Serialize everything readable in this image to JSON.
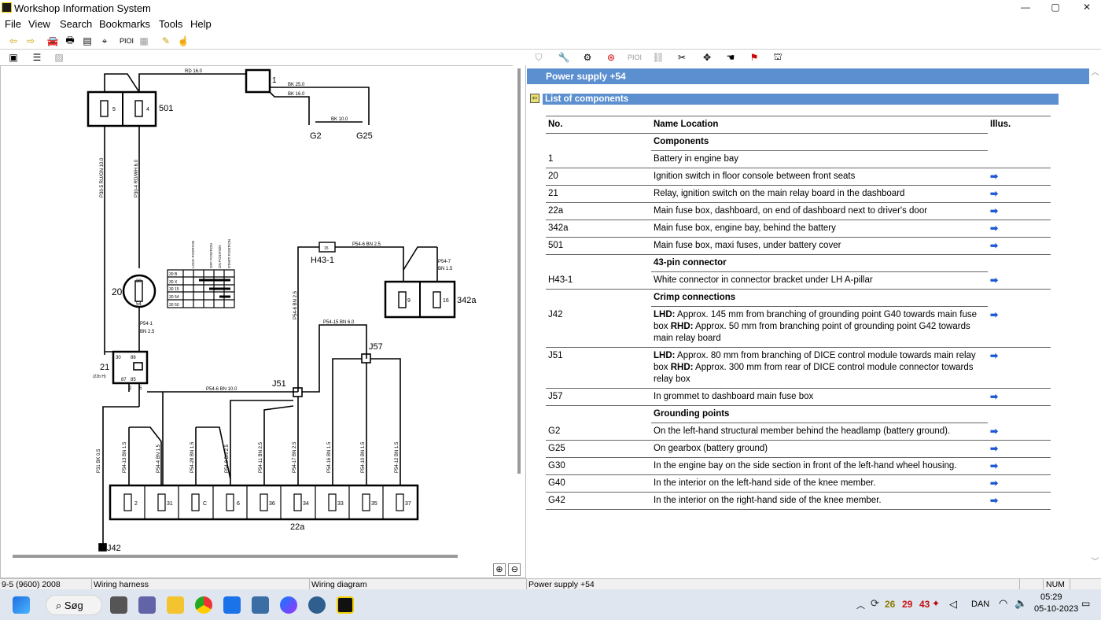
{
  "window": {
    "title": "Workshop Information System"
  },
  "menu": [
    "File",
    "View",
    "Search",
    "Bookmarks",
    "Tools",
    "Help"
  ],
  "right_panel": {
    "header": "Power supply +54",
    "list_title": "List of components",
    "columns": {
      "no": "No.",
      "name": "Name Location",
      "illus": "Illus."
    },
    "rows": [
      {
        "group": "Components"
      },
      {
        "no": "1",
        "name": "Battery in engine bay",
        "arrow": ""
      },
      {
        "no": "20",
        "name": "Ignition switch in floor console between front seats",
        "arrow": "➡"
      },
      {
        "no": "21",
        "name": "Relay, ignition switch on the main relay board in the dashboard",
        "arrow": "➡"
      },
      {
        "no": "22a",
        "name": "Main fuse box, dashboard, on end of dashboard next to driver's door",
        "arrow": "➡"
      },
      {
        "no": "342a",
        "name": "Main fuse box, engine bay, behind the battery",
        "arrow": "➡"
      },
      {
        "no": "501",
        "name": "Main fuse box, maxi fuses, under battery cover",
        "arrow": "➡"
      },
      {
        "group": "43-pin connector"
      },
      {
        "no": "H43-1",
        "name": "White connector in connector bracket under LH A-pillar",
        "arrow": "➡"
      },
      {
        "group": "Crimp connections"
      },
      {
        "no": "J42",
        "lhd": "LHD:",
        "name_a": " Approx. 145 mm from branching of grounding point G40 towards main fuse box ",
        "rhd": "RHD:",
        "name_b": " Approx. 50 mm from branching point of grounding point G42 towards main relay board",
        "arrow": "➡"
      },
      {
        "no": "J51",
        "lhd": "LHD:",
        "name_a": " Approx. 80 mm from branching of DICE control module towards main relay box ",
        "rhd": "RHD:",
        "name_b": " Approx. 300 mm from rear of DICE control module connector towards relay box",
        "arrow": "➡"
      },
      {
        "no": "J57",
        "name": "In grommet to dashboard main fuse box",
        "arrow": "➡"
      },
      {
        "group": "Grounding points"
      },
      {
        "no": "G2",
        "name": "On the left-hand structural member behind the headlamp (battery ground).",
        "arrow": "➡"
      },
      {
        "no": "G25",
        "name": "On gearbox (battery ground)",
        "arrow": "➡"
      },
      {
        "no": "G30",
        "name": "In the engine bay on the side section in front of the left-hand wheel housing.",
        "arrow": "➡"
      },
      {
        "no": "G40",
        "name": "In the interior on the left-hand side of the knee member.",
        "arrow": "➡"
      },
      {
        "no": "G42",
        "name": "In the interior on the right-hand side of the knee member.",
        "arrow": "➡"
      }
    ]
  },
  "diagram": {
    "wires": {
      "rd16": "RD 16.0",
      "bk25": "BK 25.0",
      "bk16": "BK 16.0",
      "bk10": "BK 10.0",
      "p305": "P30-5 RU/GN 10.0",
      "p304": "P30-4 RD/WH 6.0",
      "p541": "P54-1",
      "p541b": "BN 2.5",
      "p546a": "P54-6 BN 2.5",
      "p546b": "P54-6 BN 10.0",
      "p546c": "P54-6 BN 2.5",
      "p547": "P54-7",
      "p547b": "BN 1.5",
      "p5415": "P54-15 BN 6.0",
      "p31": "P31 BK 0.5",
      "p5413": "P54-13 BN 1.5",
      "p544": "P54-4 BN 1.5",
      "p5428": "P54-28 BN 1.5",
      "p548": "P54-8 BN 2.5",
      "p5411": "P54-11 BN 2.5",
      "p5417": "P54-17 BN 2.5",
      "p5416": "P54-16 BN 1.5",
      "p5410": "P54-10 BN 1.5",
      "p5412": "P54-12 BN 1.5"
    },
    "labels": {
      "c501": "501",
      "c1": "1",
      "g2": "G2",
      "g25": "G25",
      "c20": "20",
      "c21": "21",
      "c21sub": "(22b H)",
      "h431": "H43-1",
      "c342a": "342a",
      "j51": "J51",
      "j57": "J57",
      "c22a": "22a",
      "j42": "J42",
      "f5": "5",
      "f4": "4",
      "f9": "9",
      "f16": "16",
      "f15": "15",
      "sw_lock": "LOCK POSITION",
      "sw_off": "OFF POSITION",
      "sw_on": "ON POSITION",
      "sw_start": "START POSITION",
      "sw30b": "30 B",
      "sw30x": "30 X",
      "sw3015": "30 15",
      "sw3054": "30 54",
      "sw3050": "30 50",
      "r30": "30",
      "r86": "86",
      "r85": "85",
      "r87": "87",
      "r2": "2",
      "r5": "5",
      "ign30": "30",
      "ign54": "54"
    },
    "fuses": [
      "2",
      "31",
      "C",
      "6",
      "36",
      "34",
      "33",
      "35",
      "37"
    ]
  },
  "status": {
    "model": "9-5 (9600) 2008",
    "category": "Wiring harness",
    "view": "Wiring diagram",
    "doc": "Power supply +54",
    "num": "NUM"
  },
  "taskbar": {
    "search": "Søg",
    "lang": "DAN",
    "time": "05:29",
    "date": "05-10-2023",
    "n1": "26",
    "n2": "29",
    "n3": "43"
  }
}
